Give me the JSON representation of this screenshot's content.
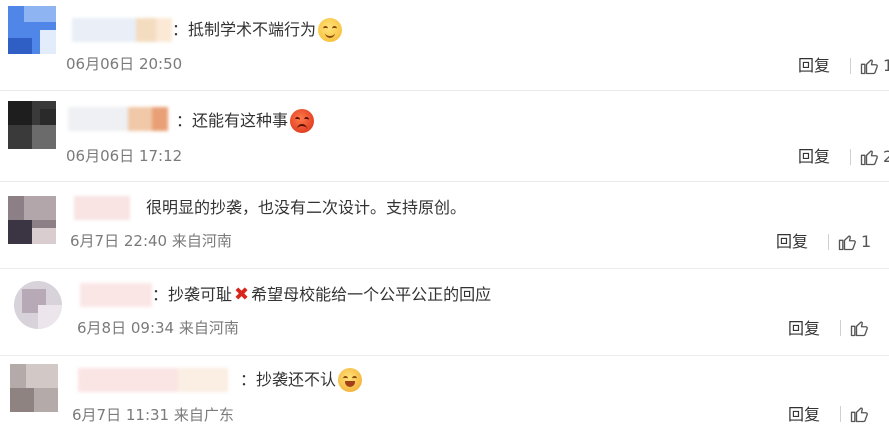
{
  "comments": [
    {
      "text": "：抵制学术不端行为",
      "emoji": "smiling-face",
      "time": "06月06日 20:50",
      "reply": "回复",
      "likes": "1"
    },
    {
      "text": "：还能有这种事",
      "emoji": "angry-face",
      "time": "06月06日 17:12",
      "reply": "回复",
      "likes": "2"
    },
    {
      "text": "很明显的抄袭，也没有二次设计。支持原创。",
      "emoji": "",
      "time": "6月7日 22:40 来自河南",
      "reply": "回复",
      "likes": "1"
    },
    {
      "text_before": "：抄袭可耻",
      "mark": "✖",
      "text_after": "希望母校能给一个公平公正的回应",
      "time": "6月8日 09:34 来自河南",
      "reply": "回复",
      "likes": ""
    },
    {
      "text": "：抄袭还不认",
      "emoji": "laughing-face",
      "time": "6月7日 11:31 来自广东",
      "reply": "回复",
      "likes": ""
    }
  ],
  "colors": {
    "meta": "#7a7a7a",
    "text": "#333333",
    "divider": "#ececec",
    "cross": "#d8261b"
  }
}
